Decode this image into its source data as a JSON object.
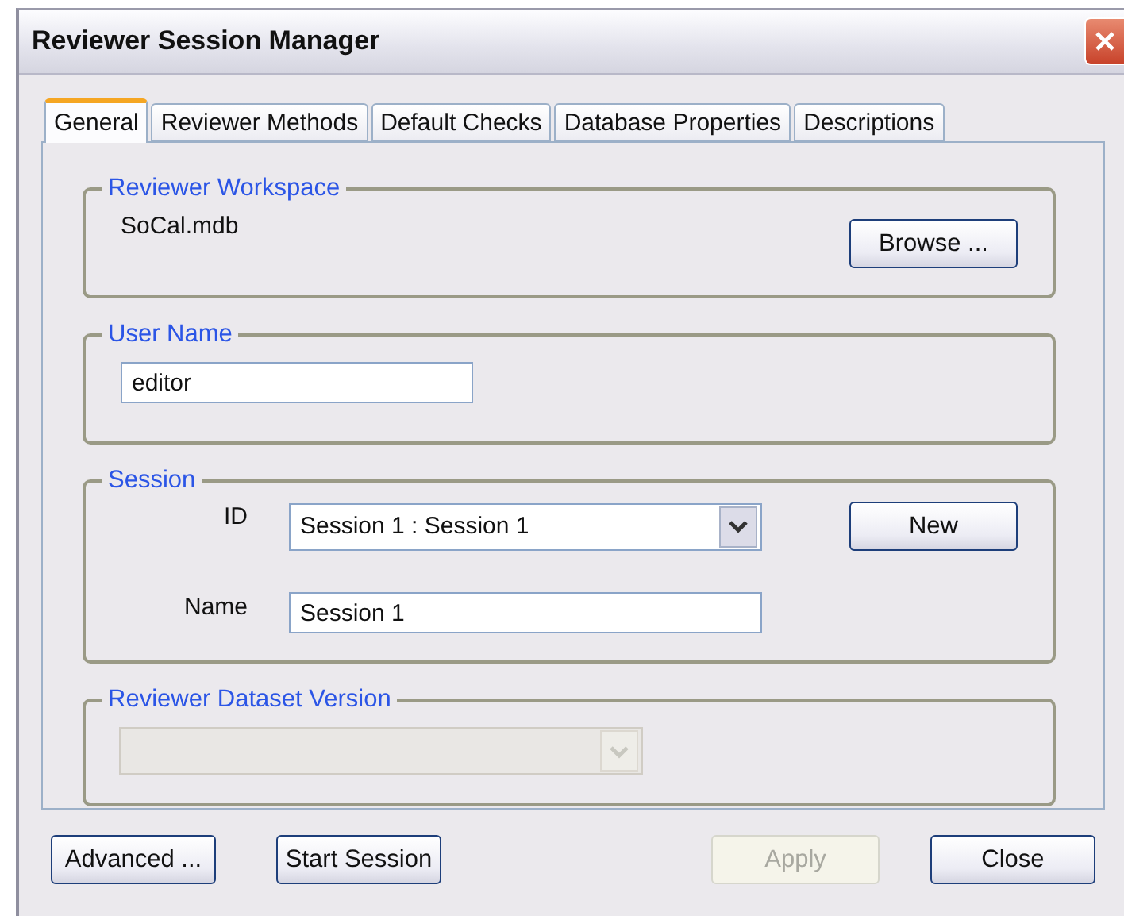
{
  "window": {
    "title": "Reviewer Session Manager"
  },
  "tabs": [
    {
      "label": "General",
      "selected": true
    },
    {
      "label": "Reviewer Methods",
      "selected": false
    },
    {
      "label": "Default Checks",
      "selected": false
    },
    {
      "label": "Database Properties",
      "selected": false
    },
    {
      "label": "Descriptions",
      "selected": false
    }
  ],
  "workspace": {
    "legend": "Reviewer Workspace",
    "value": "SoCal.mdb",
    "button": "Browse ..."
  },
  "user": {
    "legend": "User Name",
    "value": "editor"
  },
  "session": {
    "legend": "Session",
    "id_label": "ID",
    "id_value": "Session 1 : Session 1",
    "name_label": "Name",
    "name_value": "Session 1",
    "button": "New"
  },
  "dataset_version": {
    "legend": "Reviewer Dataset Version",
    "disabled": true
  },
  "left_buttons": [
    {
      "label": "Advanced ...",
      "disabled": false
    },
    {
      "label": "Start Session",
      "disabled": false
    }
  ],
  "right_buttons": [
    {
      "label": "Apply",
      "disabled": true
    },
    {
      "label": "Close",
      "disabled": false
    }
  ]
}
